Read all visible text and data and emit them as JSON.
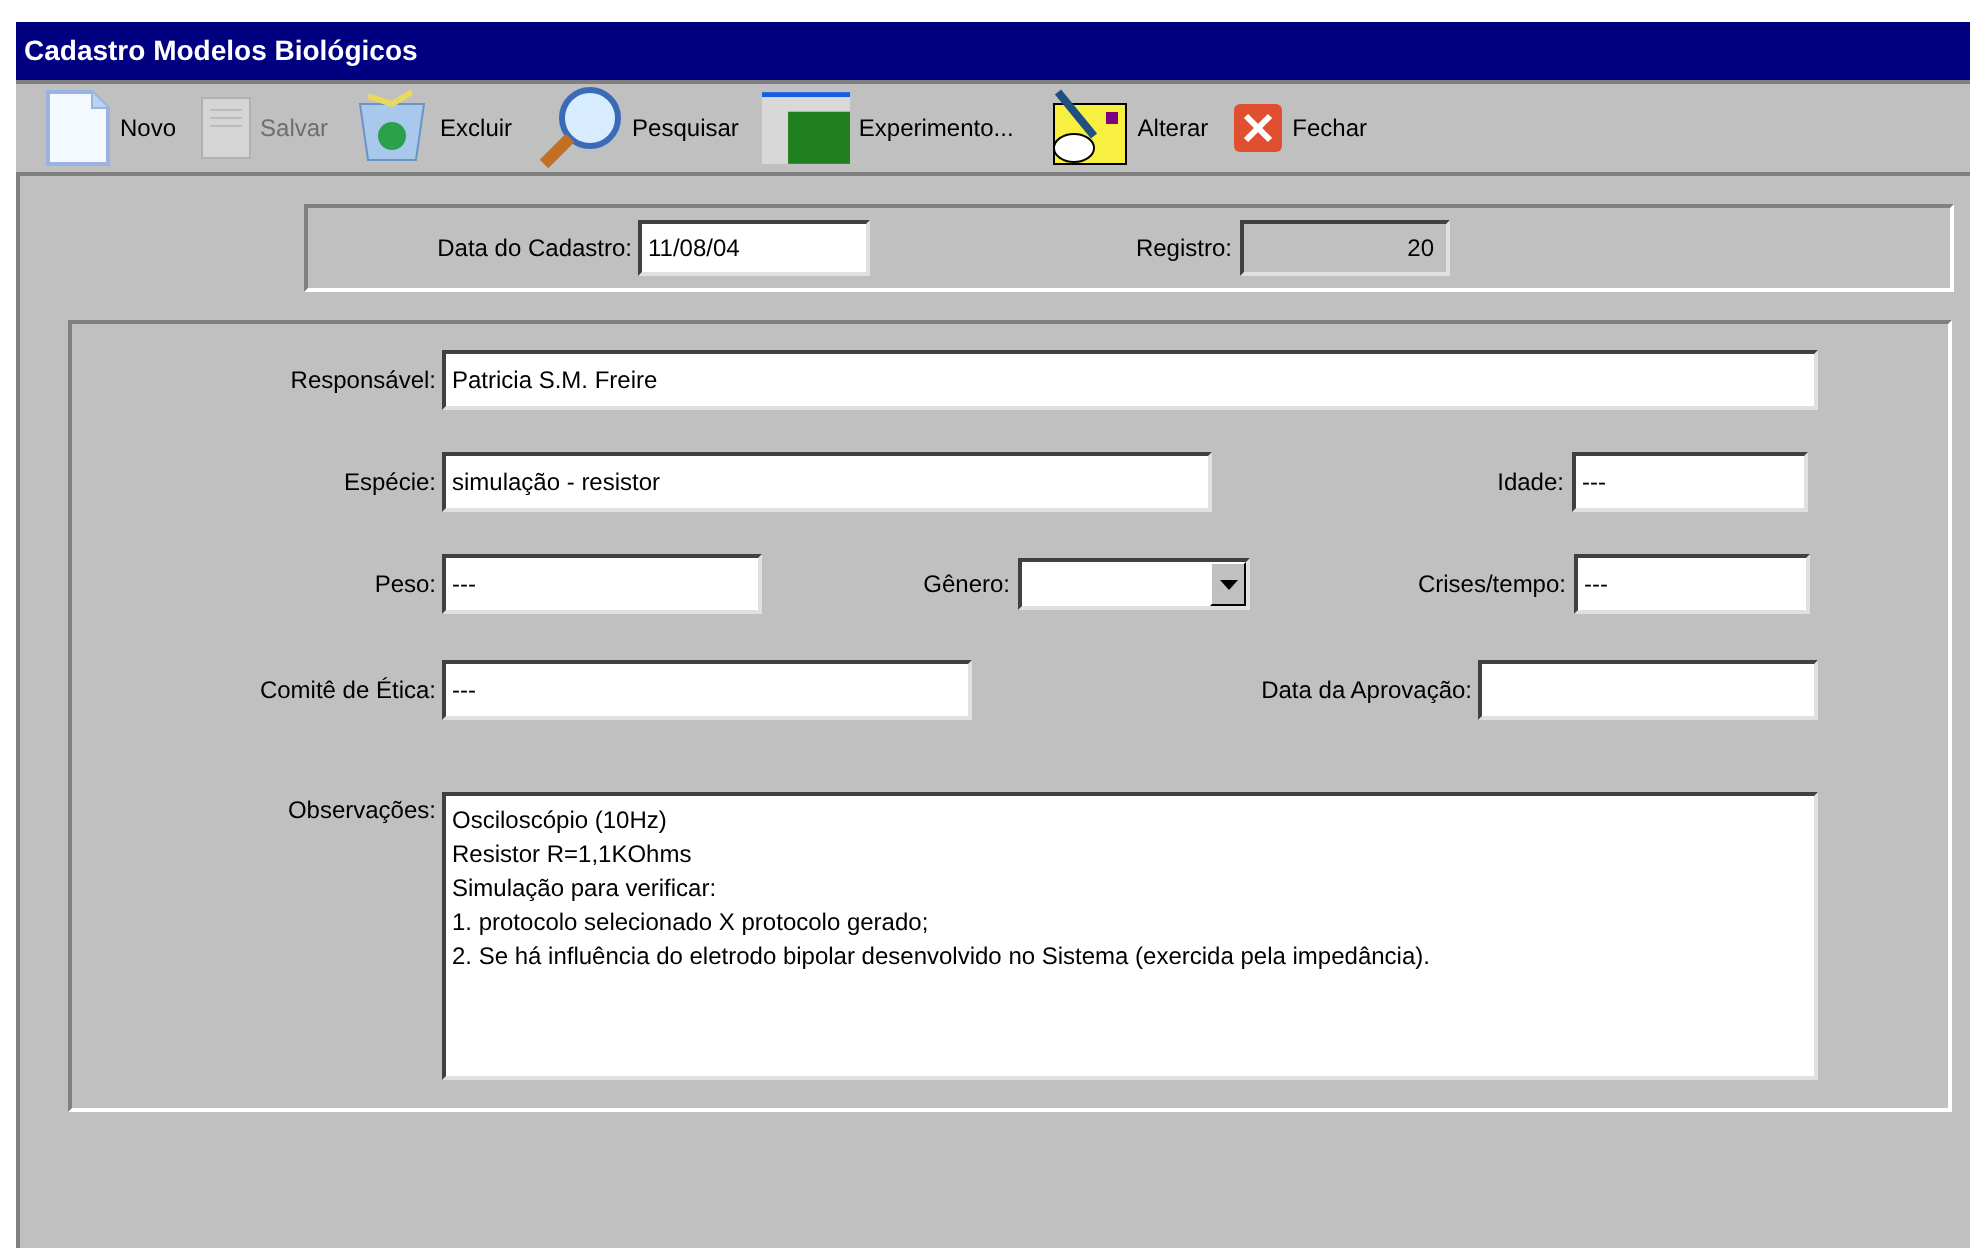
{
  "window": {
    "title": "Cadastro Modelos Biológicos"
  },
  "toolbar": [
    {
      "kind": "new",
      "label": "Novo",
      "disabled": false
    },
    {
      "kind": "save",
      "label": "Salvar",
      "disabled": true
    },
    {
      "kind": "delete",
      "label": "Excluir",
      "disabled": false
    },
    {
      "kind": "search",
      "label": "Pesquisar",
      "disabled": false
    },
    {
      "kind": "experiment",
      "label": "Experimento...",
      "disabled": false
    },
    {
      "kind": "edit",
      "label": "Alterar",
      "disabled": false
    },
    {
      "kind": "close",
      "label": "Fechar",
      "disabled": false
    }
  ],
  "header": {
    "date_label": "Data do Cadastro:",
    "date": "11/08/04",
    "registro_label": "Registro:",
    "registro": "20"
  },
  "form": {
    "responsavel_label": "Responsável:",
    "responsavel": "Patricia S.M. Freire",
    "especie_label": "Espécie:",
    "especie": "simulação - resistor",
    "idade_label": "Idade:",
    "idade": "---",
    "peso_label": "Peso:",
    "peso": "---",
    "genero_label": "Gênero:",
    "crises_label": "Crises/tempo:",
    "crises": "---",
    "comite_label": "Comitê de Ética:",
    "comite": "---",
    "aprovacao_label": "Data da Aprovação:",
    "observacoes_label": "Observações:",
    "observacoes": "Osciloscópio (10Hz)\nResistor R=1,1KOhms\nSimulação para verificar:\n1. protocolo selecionado X protocolo gerado;\n2. Se há influência do eletrodo bipolar desenvolvido no Sistema (exercida pela impedância)."
  }
}
